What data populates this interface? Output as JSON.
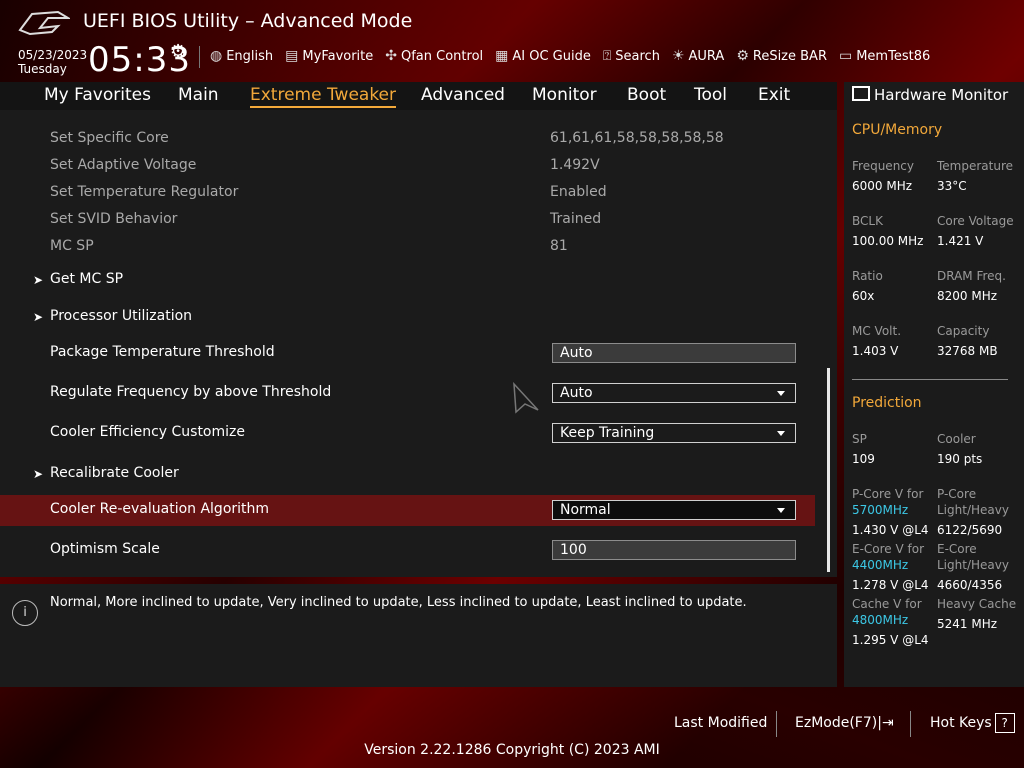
{
  "header": {
    "title": "UEFI BIOS Utility – Advanced Mode",
    "date": "05/23/2023",
    "weekday": "Tuesday",
    "time": "05:33"
  },
  "toolbar": {
    "items": [
      {
        "icon": "globe-icon",
        "label": "English"
      },
      {
        "icon": "myfavorite-icon",
        "label": "MyFavorite"
      },
      {
        "icon": "fan-icon",
        "label": "Qfan Control"
      },
      {
        "icon": "chip-icon",
        "label": "AI OC Guide"
      },
      {
        "icon": "search-icon",
        "label": "Search"
      },
      {
        "icon": "aura-icon",
        "label": "AURA"
      },
      {
        "icon": "resize-bar-icon",
        "label": "ReSize BAR"
      },
      {
        "icon": "memtest-icon",
        "label": "MemTest86"
      }
    ]
  },
  "tabs": [
    {
      "label": "My Favorites"
    },
    {
      "label": "Main"
    },
    {
      "label": "Extreme Tweaker",
      "active": true
    },
    {
      "label": "Advanced"
    },
    {
      "label": "Monitor"
    },
    {
      "label": "Boot"
    },
    {
      "label": "Tool"
    },
    {
      "label": "Exit"
    }
  ],
  "settings": {
    "info_rows": [
      {
        "label": "Set Specific Core",
        "value": "61,61,61,58,58,58,58,58"
      },
      {
        "label": "Set Adaptive Voltage",
        "value": "1.492V"
      },
      {
        "label": "Set Temperature Regulator",
        "value": "Enabled"
      },
      {
        "label": "Set SVID Behavior",
        "value": "Trained"
      },
      {
        "label": "MC SP",
        "value": "81"
      }
    ],
    "get_mc_sp": "Get MC SP",
    "processor_utilization": "Processor Utilization",
    "package_temp_threshold": {
      "label": "Package Temperature Threshold",
      "value": "Auto"
    },
    "regulate_frequency": {
      "label": "Regulate Frequency by above Threshold",
      "value": "Auto"
    },
    "cooler_efficiency": {
      "label": "Cooler Efficiency Customize",
      "value": "Keep Training"
    },
    "recalibrate_cooler": "Recalibrate Cooler",
    "cooler_reeval": {
      "label": "Cooler Re-evaluation Algorithm",
      "value": "Normal"
    },
    "optimism_scale": {
      "label": "Optimism Scale",
      "value": "100"
    }
  },
  "help": {
    "text": "Normal, More inclined to update, Very inclined to update, Less inclined to update, Least inclined to update."
  },
  "hardware_monitor": {
    "title": "Hardware Monitor",
    "cpu_memory": {
      "heading": "CPU/Memory",
      "frequency_label": "Frequency",
      "frequency": "6000 MHz",
      "temperature_label": "Temperature",
      "temperature": "33°C",
      "bclk_label": "BCLK",
      "bclk": "100.00 MHz",
      "core_voltage_label": "Core Voltage",
      "core_voltage": "1.421 V",
      "ratio_label": "Ratio",
      "ratio": "60x",
      "dram_freq_label": "DRAM Freq.",
      "dram_freq": "8200 MHz",
      "mc_volt_label": "MC Volt.",
      "mc_volt": "1.403 V",
      "capacity_label": "Capacity",
      "capacity": "32768 MB"
    },
    "prediction": {
      "heading": "Prediction",
      "sp_label": "SP",
      "sp": "109",
      "cooler_label": "Cooler",
      "cooler": "190 pts",
      "pcore_v_label": "P-Core V for",
      "pcore_v_freq": "5700MHz",
      "pcore_v": "1.430 V @L4",
      "pcore_lh_label1": "P-Core",
      "pcore_lh_label2": "Light/Heavy",
      "pcore_lh": "6122/5690",
      "ecore_v_label": "E-Core V for",
      "ecore_v_freq": "4400MHz",
      "ecore_v": "1.278 V @L4",
      "ecore_lh_label1": "E-Core",
      "ecore_lh_label2": "Light/Heavy",
      "ecore_lh": "4660/4356",
      "cache_v_label": "Cache V for",
      "cache_v_freq": "4800MHz",
      "cache_v": "1.295 V @L4",
      "heavy_cache_label": "Heavy Cache",
      "heavy_cache": "5241 MHz"
    }
  },
  "footer": {
    "last_modified": "Last Modified",
    "ezmode": "EzMode(F7)|",
    "hotkeys": "Hot Keys",
    "hotkeys_icon": "?",
    "version": "Version 2.22.1286 Copyright (C) 2023 AMI"
  }
}
